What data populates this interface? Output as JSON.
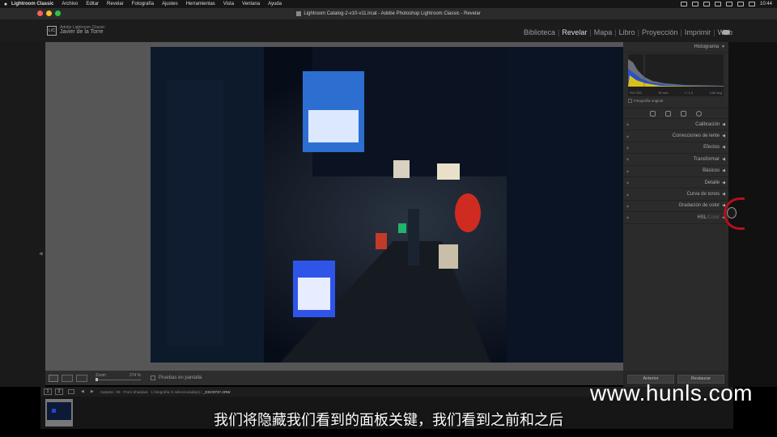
{
  "menubar": {
    "app": "Lightroom Classic",
    "items": [
      "Archivo",
      "Editar",
      "Revelar",
      "Fotografía",
      "Ajustes",
      "Herramientas",
      "Vista",
      "Ventana",
      "Ayuda"
    ],
    "clock": "10:44"
  },
  "window": {
    "title": "Lightroom Catalog-2-v10-v11.lrcat - Adobe Photoshop Lightroom Classic - Revelar"
  },
  "identity": {
    "logo": "LrC",
    "product": "Adobe Lightroom Classic",
    "user": "Javier de la Torre"
  },
  "modules": [
    "Biblioteca",
    "Revelar",
    "Mapa",
    "Libro",
    "Proyección",
    "Imprimir",
    "Web"
  ],
  "active_module": "Revelar",
  "right_panel": {
    "histogram_title": "Histograma",
    "hist_meta": [
      "ISO 320",
      "35 mm",
      "f / 1,4",
      "1/40 seg"
    ],
    "original_photo": "Fotografía original",
    "sections": [
      "Calibración",
      "Correcciones de lente",
      "Efectos",
      "Transformar",
      "Básicos",
      "Detalle",
      "Curva de tonos",
      "Gradación de color"
    ],
    "hsl": "HSL",
    "hsl_sep": " / ",
    "color": "Color",
    "btn_previous": "Anterior",
    "btn_reset": "Restaurar"
  },
  "toolbar": {
    "zoom_label": "Zoom",
    "zoom_value": "274 %",
    "soft_proofing": "Pruebas en pantalla"
  },
  "filmbar": {
    "page1": "1",
    "page2": "2",
    "path": "Carpeta : 06 - From Shadows",
    "count": "1 fotografía /1 seleccionada(s) /",
    "file": "_DSC9737.ARW"
  },
  "overlay": {
    "watermark": "www.hunls.com",
    "subtitle": "我们将隐藏我们看到的面板关键，我们看到之前和之后"
  },
  "colors": {
    "accent_red": "#b3101b",
    "photo_blue": "#1b3f8f",
    "lantern_red": "#d02b20"
  }
}
